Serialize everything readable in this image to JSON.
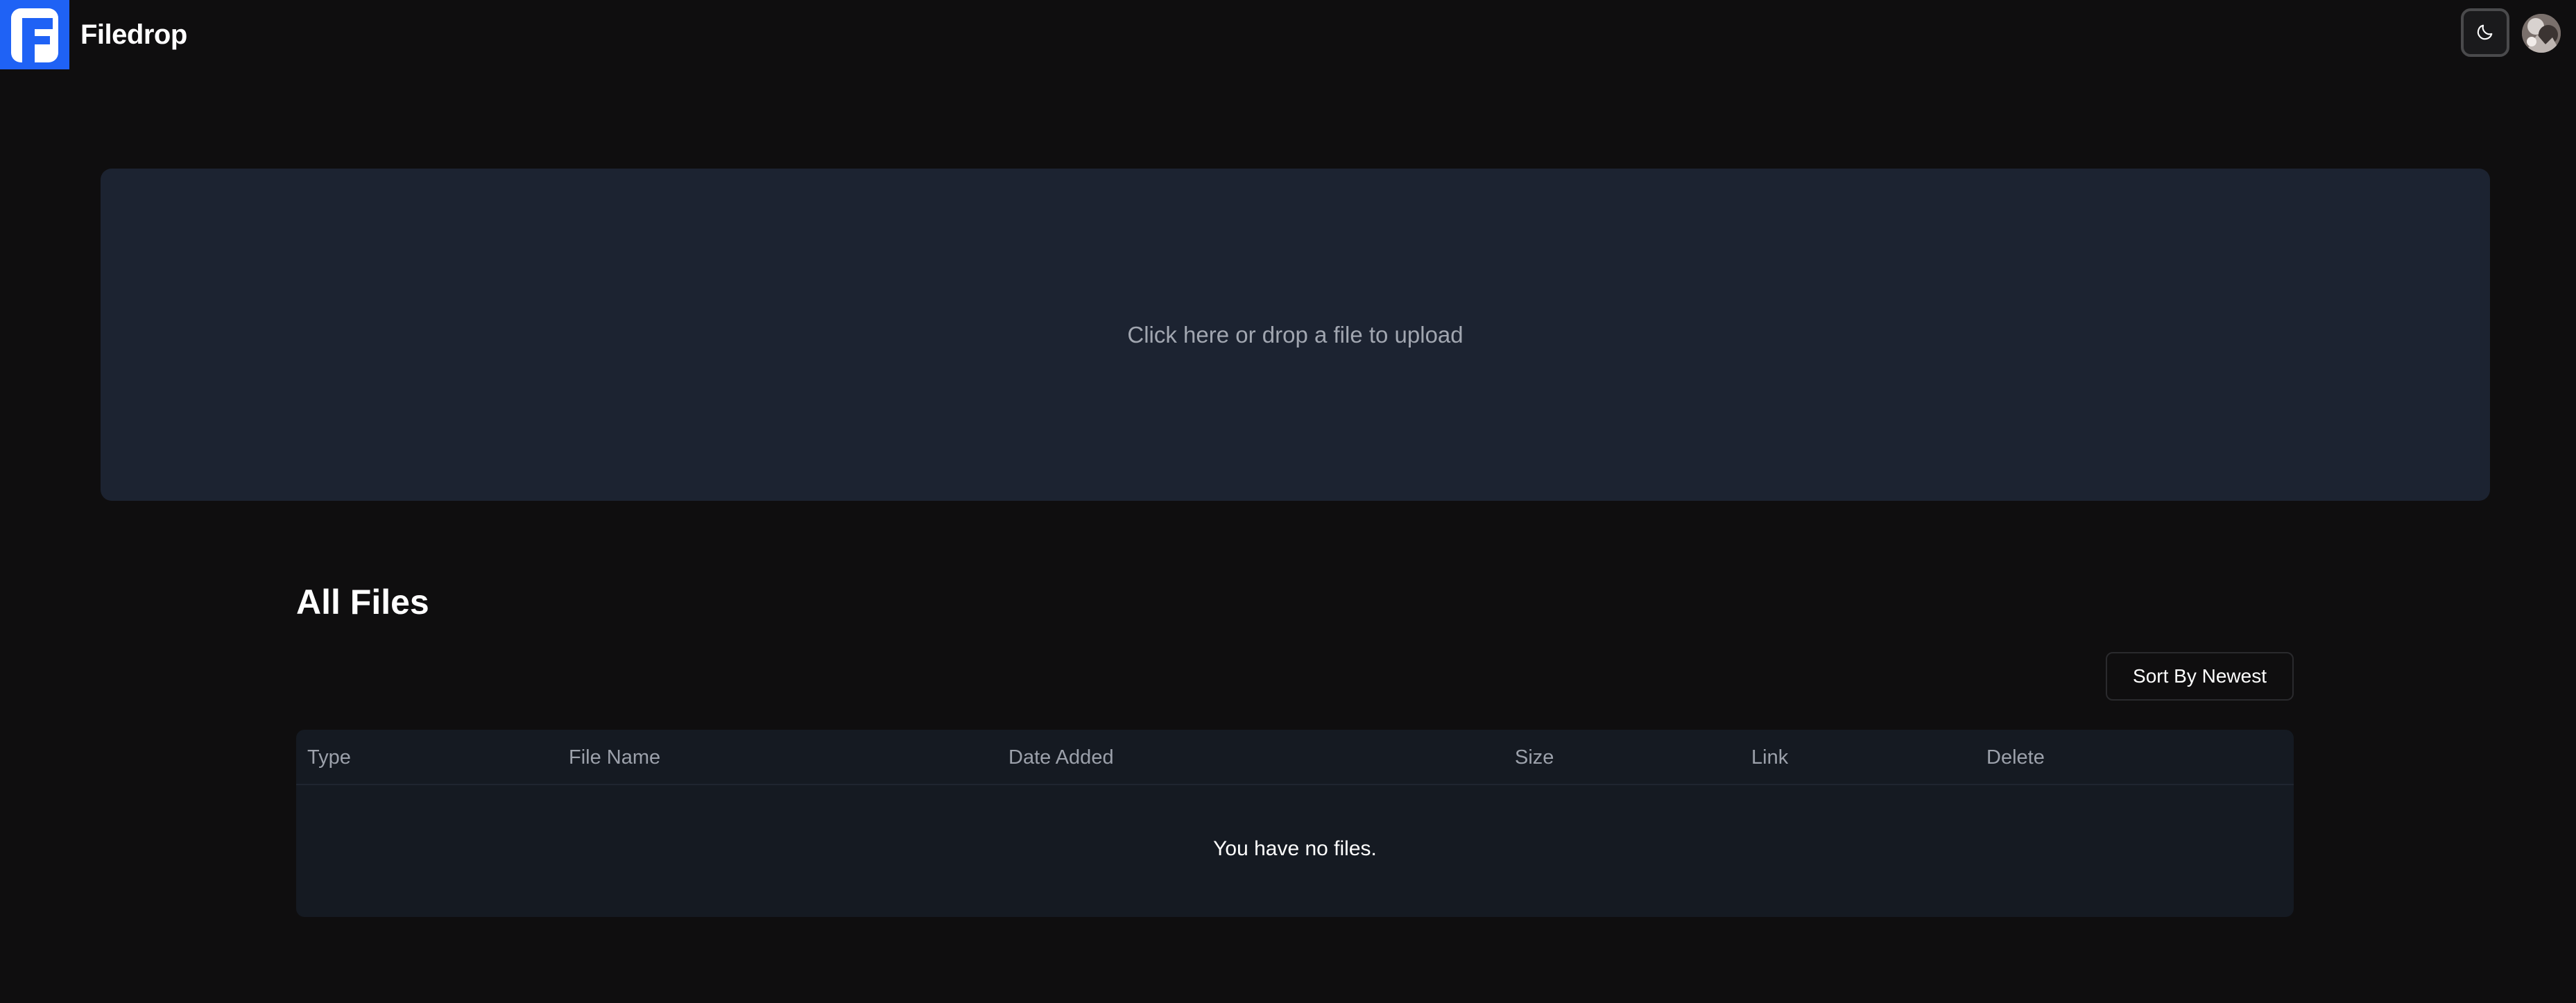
{
  "header": {
    "brand": "Filedrop",
    "logo_icon": "filedrop-f-logo",
    "theme_toggle_icon": "moon-icon",
    "avatar_icon": "user-avatar"
  },
  "upload": {
    "prompt": "Click here or drop a file to upload"
  },
  "files": {
    "title": "All Files",
    "sort_label": "Sort By Newest",
    "columns": [
      "Type",
      "File Name",
      "Date Added",
      "Size",
      "Link",
      "Delete"
    ],
    "empty_message": "You have no files."
  },
  "colors": {
    "background": "#0f0e0f",
    "brand_blue": "#1f62f5",
    "dropzone": "#1c2331",
    "table": "#151a22"
  }
}
